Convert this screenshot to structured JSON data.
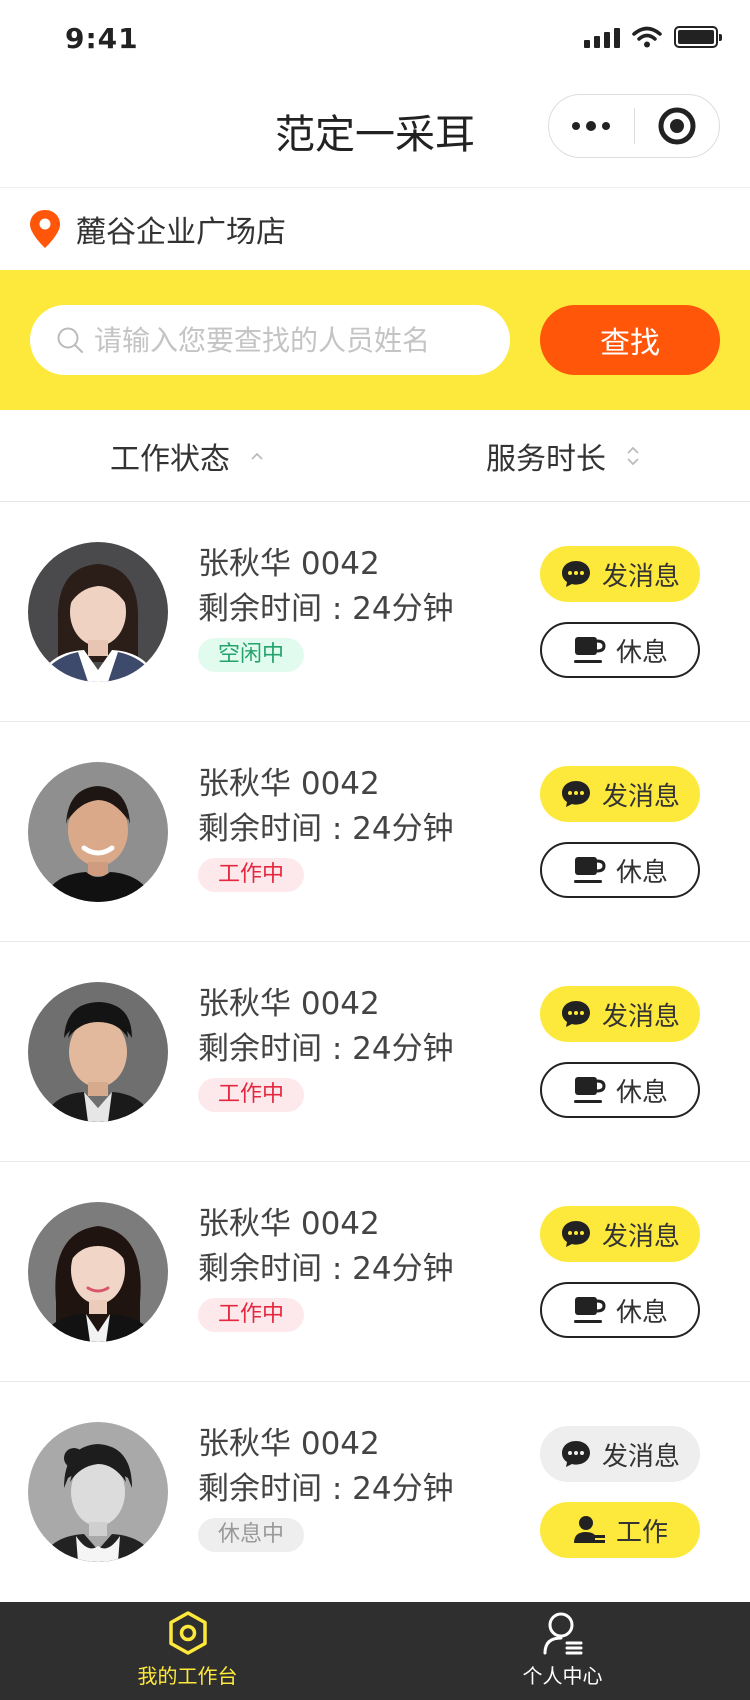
{
  "status_bar": {
    "time": "9:41"
  },
  "navbar": {
    "title": "范定一采耳"
  },
  "store": {
    "name": "麓谷企业广场店"
  },
  "search": {
    "placeholder": "请输入您要查找的人员姓名",
    "button_label": "查找"
  },
  "sort": {
    "work_status_label": "工作状态",
    "service_duration_label": "服务时长"
  },
  "staff": [
    {
      "name": "张秋华 0042",
      "remaining": "剩余时间 : 24分钟",
      "status": "空闲中",
      "msg_label": "发消息",
      "action_label": "休息"
    },
    {
      "name": "张秋华 0042",
      "remaining": "剩余时间 : 24分钟",
      "status": "工作中",
      "msg_label": "发消息",
      "action_label": "休息"
    },
    {
      "name": "张秋华 0042",
      "remaining": "剩余时间 : 24分钟",
      "status": "工作中",
      "msg_label": "发消息",
      "action_label": "休息"
    },
    {
      "name": "张秋华 0042",
      "remaining": "剩余时间 : 24分钟",
      "status": "工作中",
      "msg_label": "发消息",
      "action_label": "休息"
    },
    {
      "name": "张秋华 0042",
      "remaining": "剩余时间 : 24分钟",
      "status": "休息中",
      "msg_label": "发消息",
      "action_label": "工作"
    }
  ],
  "tabbar": {
    "workbench_label": "我的工作台",
    "profile_label": "个人中心"
  },
  "colors": {
    "accent_yellow": "#fde93b",
    "search_orange": "#ff5609",
    "idle_green": "#24a36b",
    "working_red": "#e4283f",
    "tabbar_bg": "#2f2f2f"
  },
  "icons": [
    "location-pin-icon",
    "search-icon",
    "more-dots-icon",
    "target-icon",
    "sort-up-icon",
    "sort-updown-icon",
    "chat-bubble-icon",
    "coffee-cup-icon",
    "user-work-icon",
    "workbench-hex-icon",
    "user-profile-icon"
  ]
}
